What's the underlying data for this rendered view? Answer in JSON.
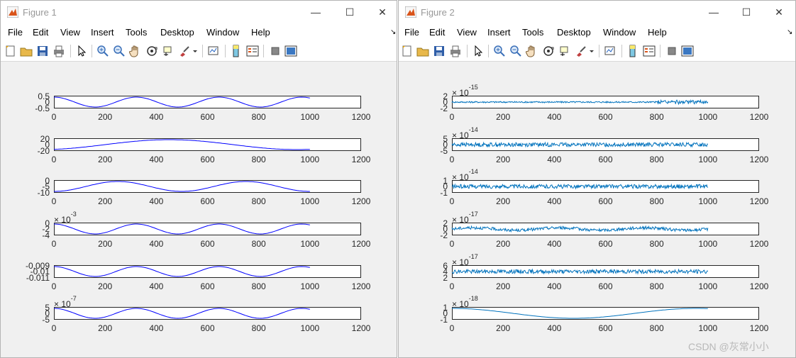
{
  "figures": [
    {
      "title": "Figure 1",
      "menu": [
        "File",
        "Edit",
        "View",
        "Insert",
        "Tools",
        "Desktop",
        "Window",
        "Help"
      ],
      "line_color": "#0000ff",
      "subplots": [
        {
          "yticks": [
            "0.5",
            "0",
            "-0.5"
          ],
          "exponent": "",
          "xticks": [
            "0",
            "200",
            "400",
            "600",
            "800",
            "1000",
            "1200"
          ],
          "curve": "cos3"
        },
        {
          "yticks": [
            "20",
            "0",
            "-20"
          ],
          "exponent": "",
          "xticks": [
            "0",
            "200",
            "400",
            "600",
            "800",
            "1000",
            "1200"
          ],
          "curve": "cos1"
        },
        {
          "yticks": [
            "0",
            "-5",
            "-10"
          ],
          "exponent": "",
          "xticks": [
            "0",
            "200",
            "400",
            "600",
            "800",
            "1000",
            "1200"
          ],
          "curve": "cos2"
        },
        {
          "yticks": [
            "0",
            "-2",
            "-4"
          ],
          "exponent": "-3",
          "xticks": [
            "0",
            "200",
            "400",
            "600",
            "800",
            "1000",
            "1200"
          ],
          "curve": "cos3"
        },
        {
          "yticks": [
            "-0.009",
            "-0.01",
            "-0.011"
          ],
          "exponent": "",
          "xticks": [
            "0",
            "200",
            "400",
            "600",
            "800",
            "1000",
            "1200"
          ],
          "curve": "cos3"
        },
        {
          "yticks": [
            "5",
            "0",
            "-5"
          ],
          "exponent": "-7",
          "xticks": [
            "0",
            "200",
            "400",
            "600",
            "800",
            "1000",
            "1200"
          ],
          "curve": "cos3"
        }
      ]
    },
    {
      "title": "Figure 2",
      "menu": [
        "File",
        "Edit",
        "View",
        "Insert",
        "Tools",
        "Desktop",
        "Window",
        "Help"
      ],
      "line_color": "#0072bd",
      "subplots": [
        {
          "yticks": [
            "2",
            "0",
            "-2"
          ],
          "exponent": "-15",
          "xticks": [
            "0",
            "200",
            "400",
            "600",
            "800",
            "1000",
            "1200"
          ],
          "curve": "noise-small"
        },
        {
          "yticks": [
            "5",
            "0",
            "-5"
          ],
          "exponent": "-14",
          "xticks": [
            "0",
            "200",
            "400",
            "600",
            "800",
            "1000",
            "1200"
          ],
          "curve": "noise"
        },
        {
          "yticks": [
            "1",
            "0",
            "-1"
          ],
          "exponent": "-14",
          "xticks": [
            "0",
            "200",
            "400",
            "600",
            "800",
            "1000",
            "1200"
          ],
          "curve": "noise"
        },
        {
          "yticks": [
            "2",
            "0",
            "-2"
          ],
          "exponent": "-17",
          "xticks": [
            "0",
            "200",
            "400",
            "600",
            "800",
            "1000",
            "1200"
          ],
          "curve": "noise-wave"
        },
        {
          "yticks": [
            "6",
            "4",
            "2"
          ],
          "exponent": "-17",
          "xticks": [
            "0",
            "200",
            "400",
            "600",
            "800",
            "1000",
            "1200"
          ],
          "curve": "noise"
        },
        {
          "yticks": [
            "1",
            "0",
            "-1"
          ],
          "exponent": "-18",
          "xticks": [
            "0",
            "200",
            "400",
            "600",
            "800",
            "1000",
            "1200"
          ],
          "curve": "smooth"
        }
      ]
    }
  ],
  "window_buttons": {
    "minimize": "—",
    "maximize": "☐",
    "close": "✕"
  },
  "exponent_prefix": "× 10",
  "watermark": "CSDN @灰常小小"
}
